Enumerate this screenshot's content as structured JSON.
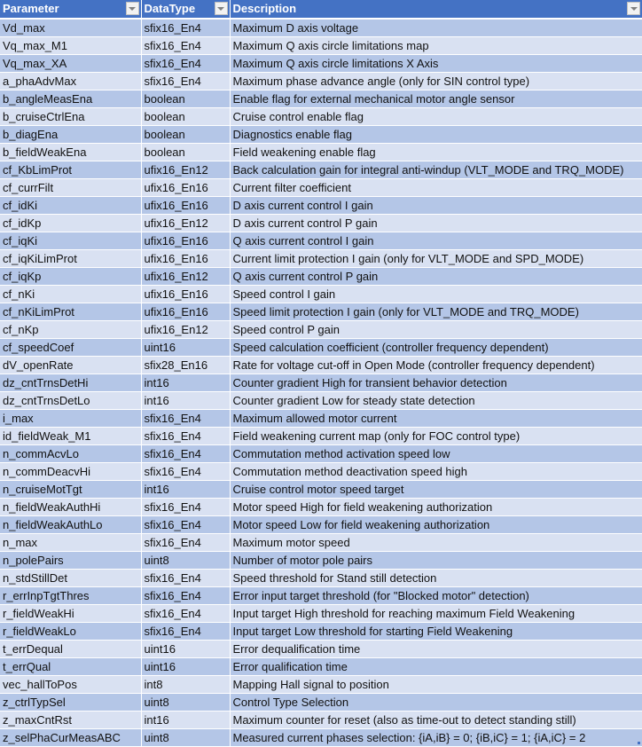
{
  "table": {
    "headers": [
      {
        "label": "Parameter",
        "filter_icon": "dropdown-arrow-icon"
      },
      {
        "label": "DataType",
        "filter_icon": "dropdown-arrow-icon"
      },
      {
        "label": "Description",
        "filter_icon": "dropdown-arrow-icon"
      }
    ],
    "rows": [
      {
        "parameter": "Vd_max",
        "datatype": "sfix16_En4",
        "description": "Maximum D axis voltage"
      },
      {
        "parameter": "Vq_max_M1",
        "datatype": "sfix16_En4",
        "description": "Maximum Q axis circle limitations map"
      },
      {
        "parameter": "Vq_max_XA",
        "datatype": "sfix16_En4",
        "description": "Maximum Q axis circle limitations X Axis"
      },
      {
        "parameter": "a_phaAdvMax",
        "datatype": "sfix16_En4",
        "description": "Maximum phase advance angle (only for SIN control type)"
      },
      {
        "parameter": "b_angleMeasEna",
        "datatype": "boolean",
        "description": "Enable flag for external mechanical motor angle sensor"
      },
      {
        "parameter": "b_cruiseCtrlEna",
        "datatype": "boolean",
        "description": "Cruise control enable flag"
      },
      {
        "parameter": "b_diagEna",
        "datatype": "boolean",
        "description": "Diagnostics enable flag"
      },
      {
        "parameter": "b_fieldWeakEna",
        "datatype": "boolean",
        "description": "Field weakening enable flag"
      },
      {
        "parameter": "cf_KbLimProt",
        "datatype": "ufix16_En12",
        "description": "Back calculation gain for integral anti-windup (VLT_MODE and TRQ_MODE)"
      },
      {
        "parameter": "cf_currFilt",
        "datatype": "ufix16_En16",
        "description": "Current filter coefficient"
      },
      {
        "parameter": "cf_idKi",
        "datatype": "ufix16_En16",
        "description": "D axis current control I gain"
      },
      {
        "parameter": "cf_idKp",
        "datatype": "ufix16_En12",
        "description": "D axis current control P gain"
      },
      {
        "parameter": "cf_iqKi",
        "datatype": "ufix16_En16",
        "description": "Q axis current control I gain"
      },
      {
        "parameter": "cf_iqKiLimProt",
        "datatype": "ufix16_En16",
        "description": "Current limit protection I gain (only for VLT_MODE and SPD_MODE)"
      },
      {
        "parameter": "cf_iqKp",
        "datatype": "ufix16_En12",
        "description": "Q axis current control P gain"
      },
      {
        "parameter": "cf_nKi",
        "datatype": "ufix16_En16",
        "description": "Speed control I gain"
      },
      {
        "parameter": "cf_nKiLimProt",
        "datatype": "ufix16_En16",
        "description": "Speed limit protection I gain (only for VLT_MODE and TRQ_MODE)"
      },
      {
        "parameter": "cf_nKp",
        "datatype": "ufix16_En12",
        "description": "Speed control P gain"
      },
      {
        "parameter": "cf_speedCoef",
        "datatype": "uint16",
        "description": "Speed calculation coefficient (controller frequency dependent)"
      },
      {
        "parameter": "dV_openRate",
        "datatype": "sfix28_En16",
        "description": "Rate for voltage cut-off in Open Mode (controller frequency dependent)"
      },
      {
        "parameter": "dz_cntTrnsDetHi",
        "datatype": "int16",
        "description": "Counter gradient High for transient behavior detection"
      },
      {
        "parameter": "dz_cntTrnsDetLo",
        "datatype": "int16",
        "description": "Counter gradient Low for steady state detection"
      },
      {
        "parameter": "i_max",
        "datatype": "sfix16_En4",
        "description": "Maximum allowed motor current"
      },
      {
        "parameter": "id_fieldWeak_M1",
        "datatype": "sfix16_En4",
        "description": "Field weakening current map (only for FOC control type)"
      },
      {
        "parameter": "n_commAcvLo",
        "datatype": "sfix16_En4",
        "description": "Commutation method activation speed low"
      },
      {
        "parameter": "n_commDeacvHi",
        "datatype": "sfix16_En4",
        "description": "Commutation method deactivation speed high"
      },
      {
        "parameter": "n_cruiseMotTgt",
        "datatype": "int16",
        "description": "Cruise control motor speed target"
      },
      {
        "parameter": "n_fieldWeakAuthHi",
        "datatype": "sfix16_En4",
        "description": "Motor speed High for field weakening authorization"
      },
      {
        "parameter": "n_fieldWeakAuthLo",
        "datatype": "sfix16_En4",
        "description": "Motor speed Low for field weakening authorization"
      },
      {
        "parameter": "n_max",
        "datatype": "sfix16_En4",
        "description": "Maximum motor speed"
      },
      {
        "parameter": "n_polePairs",
        "datatype": "uint8",
        "description": "Number of motor pole pairs"
      },
      {
        "parameter": "n_stdStillDet",
        "datatype": "sfix16_En4",
        "description": "Speed threshold for Stand still detection"
      },
      {
        "parameter": "r_errInpTgtThres",
        "datatype": "sfix16_En4",
        "description": "Error input target threshold (for \"Blocked motor\" detection)"
      },
      {
        "parameter": "r_fieldWeakHi",
        "datatype": "sfix16_En4",
        "description": "Input target High threshold for reaching maximum Field Weakening"
      },
      {
        "parameter": "r_fieldWeakLo",
        "datatype": "sfix16_En4",
        "description": "Input target Low threshold for starting Field Weakening"
      },
      {
        "parameter": "t_errDequal",
        "datatype": "uint16",
        "description": "Error dequalification time"
      },
      {
        "parameter": "t_errQual",
        "datatype": "uint16",
        "description": "Error qualification time"
      },
      {
        "parameter": "vec_hallToPos",
        "datatype": "int8",
        "description": "Mapping Hall signal to position"
      },
      {
        "parameter": "z_ctrlTypSel",
        "datatype": "uint8",
        "description": "Control Type Selection"
      },
      {
        "parameter": "z_maxCntRst",
        "datatype": "int16",
        "description": "Maximum counter for reset (also as time-out to detect standing still)"
      },
      {
        "parameter": "z_selPhaCurMeasABC",
        "datatype": "uint8",
        "description": "Measured current phases selection: {iA,iB} = 0; {iB,iC} = 1; {iA,iC} = 2"
      }
    ]
  },
  "colors": {
    "header_bg": "#4472c4",
    "row_band_dark": "#b4c6e7",
    "row_band_light": "#d9e1f2"
  }
}
